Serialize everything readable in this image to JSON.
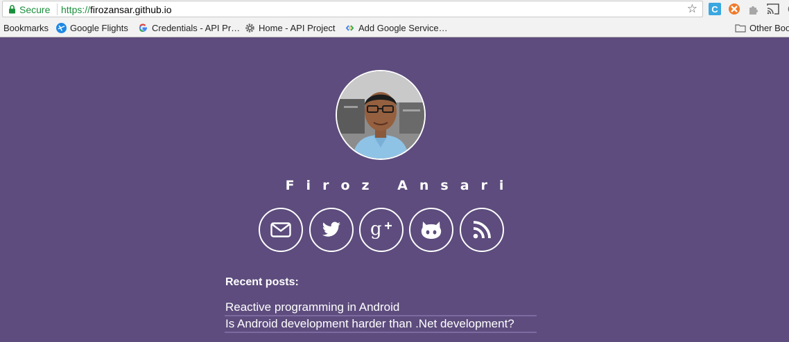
{
  "browser": {
    "security_label": "Secure",
    "url_scheme": "https://",
    "url_host": "firozansar.github.io",
    "bookmark_star_icon": "star-outline-icon",
    "extensions": [
      "c-extension-icon",
      "orange-extension-icon",
      "puzzle-extension-icon",
      "cast-icon"
    ]
  },
  "bookmarks": {
    "items": [
      {
        "label": "Bookmarks",
        "icon": ""
      },
      {
        "label": "Google Flights",
        "icon": "flights-icon"
      },
      {
        "label": "Credentials - API Pr…",
        "icon": "google-icon"
      },
      {
        "label": "Home - API Project",
        "icon": "gear-icon"
      },
      {
        "label": "Add Google Service…",
        "icon": "google-services-icon"
      }
    ],
    "other_label": "Other Boo"
  },
  "profile": {
    "name": "Firoz Ansari",
    "social": [
      {
        "name": "email",
        "icon": "envelope-icon"
      },
      {
        "name": "twitter",
        "icon": "twitter-icon"
      },
      {
        "name": "google-plus",
        "icon": "google-plus-icon"
      },
      {
        "name": "github",
        "icon": "github-icon"
      },
      {
        "name": "rss",
        "icon": "rss-icon"
      }
    ]
  },
  "recent": {
    "title": "Recent posts:",
    "posts": [
      "Reactive programming in Android",
      "Is Android development harder than .Net development?"
    ]
  },
  "colors": {
    "background": "#5d4c7d",
    "text": "#ffffff",
    "secure_green": "#1a8f3c",
    "post_underline": "#7c6aa0"
  }
}
